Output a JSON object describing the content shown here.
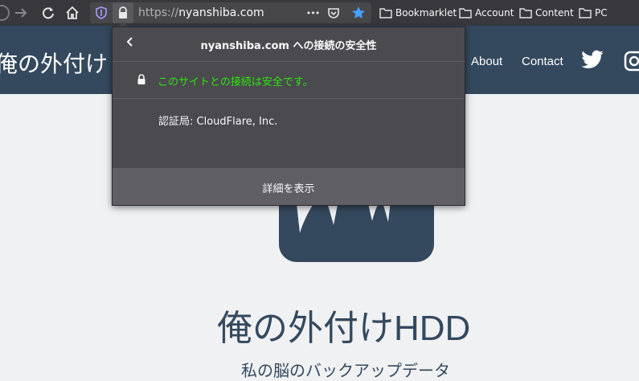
{
  "browser": {
    "url": {
      "scheme": "https://",
      "host": "nyanshiba.com"
    },
    "bookmarks": [
      {
        "label": "Bookmarklet"
      },
      {
        "label": "Account"
      },
      {
        "label": "Content"
      },
      {
        "label": "PC"
      }
    ],
    "overflow_label": "•••"
  },
  "site": {
    "header_title": "俺の外付け",
    "nav": [
      {
        "label": "About"
      },
      {
        "label": "Contact"
      }
    ],
    "hero_title": "俺の外付けHDD",
    "hero_subtitle": "私の脳のバックアップデータ"
  },
  "security_popup": {
    "title": "nyanshiba.com への接続の安全性",
    "secure_message": "このサイトとの接続は安全です。",
    "certificate_issuer": "認証局: CloudFlare, Inc.",
    "more_info_label": "詳細を表示"
  },
  "colors": {
    "toolbar_bg": "#38383d",
    "header_bg": "#34495e",
    "popup_bg": "#4a4a4f",
    "secure_green": "#30e60b",
    "star_blue": "#45a1ff"
  },
  "icons": [
    "back-icon",
    "forward-icon",
    "reload-icon",
    "home-icon",
    "tracking-shield-icon",
    "lock-icon",
    "pocket-icon",
    "bookmark-star-icon",
    "folder-icon",
    "twitter-icon",
    "instagram-icon",
    "chevron-left-icon"
  ]
}
